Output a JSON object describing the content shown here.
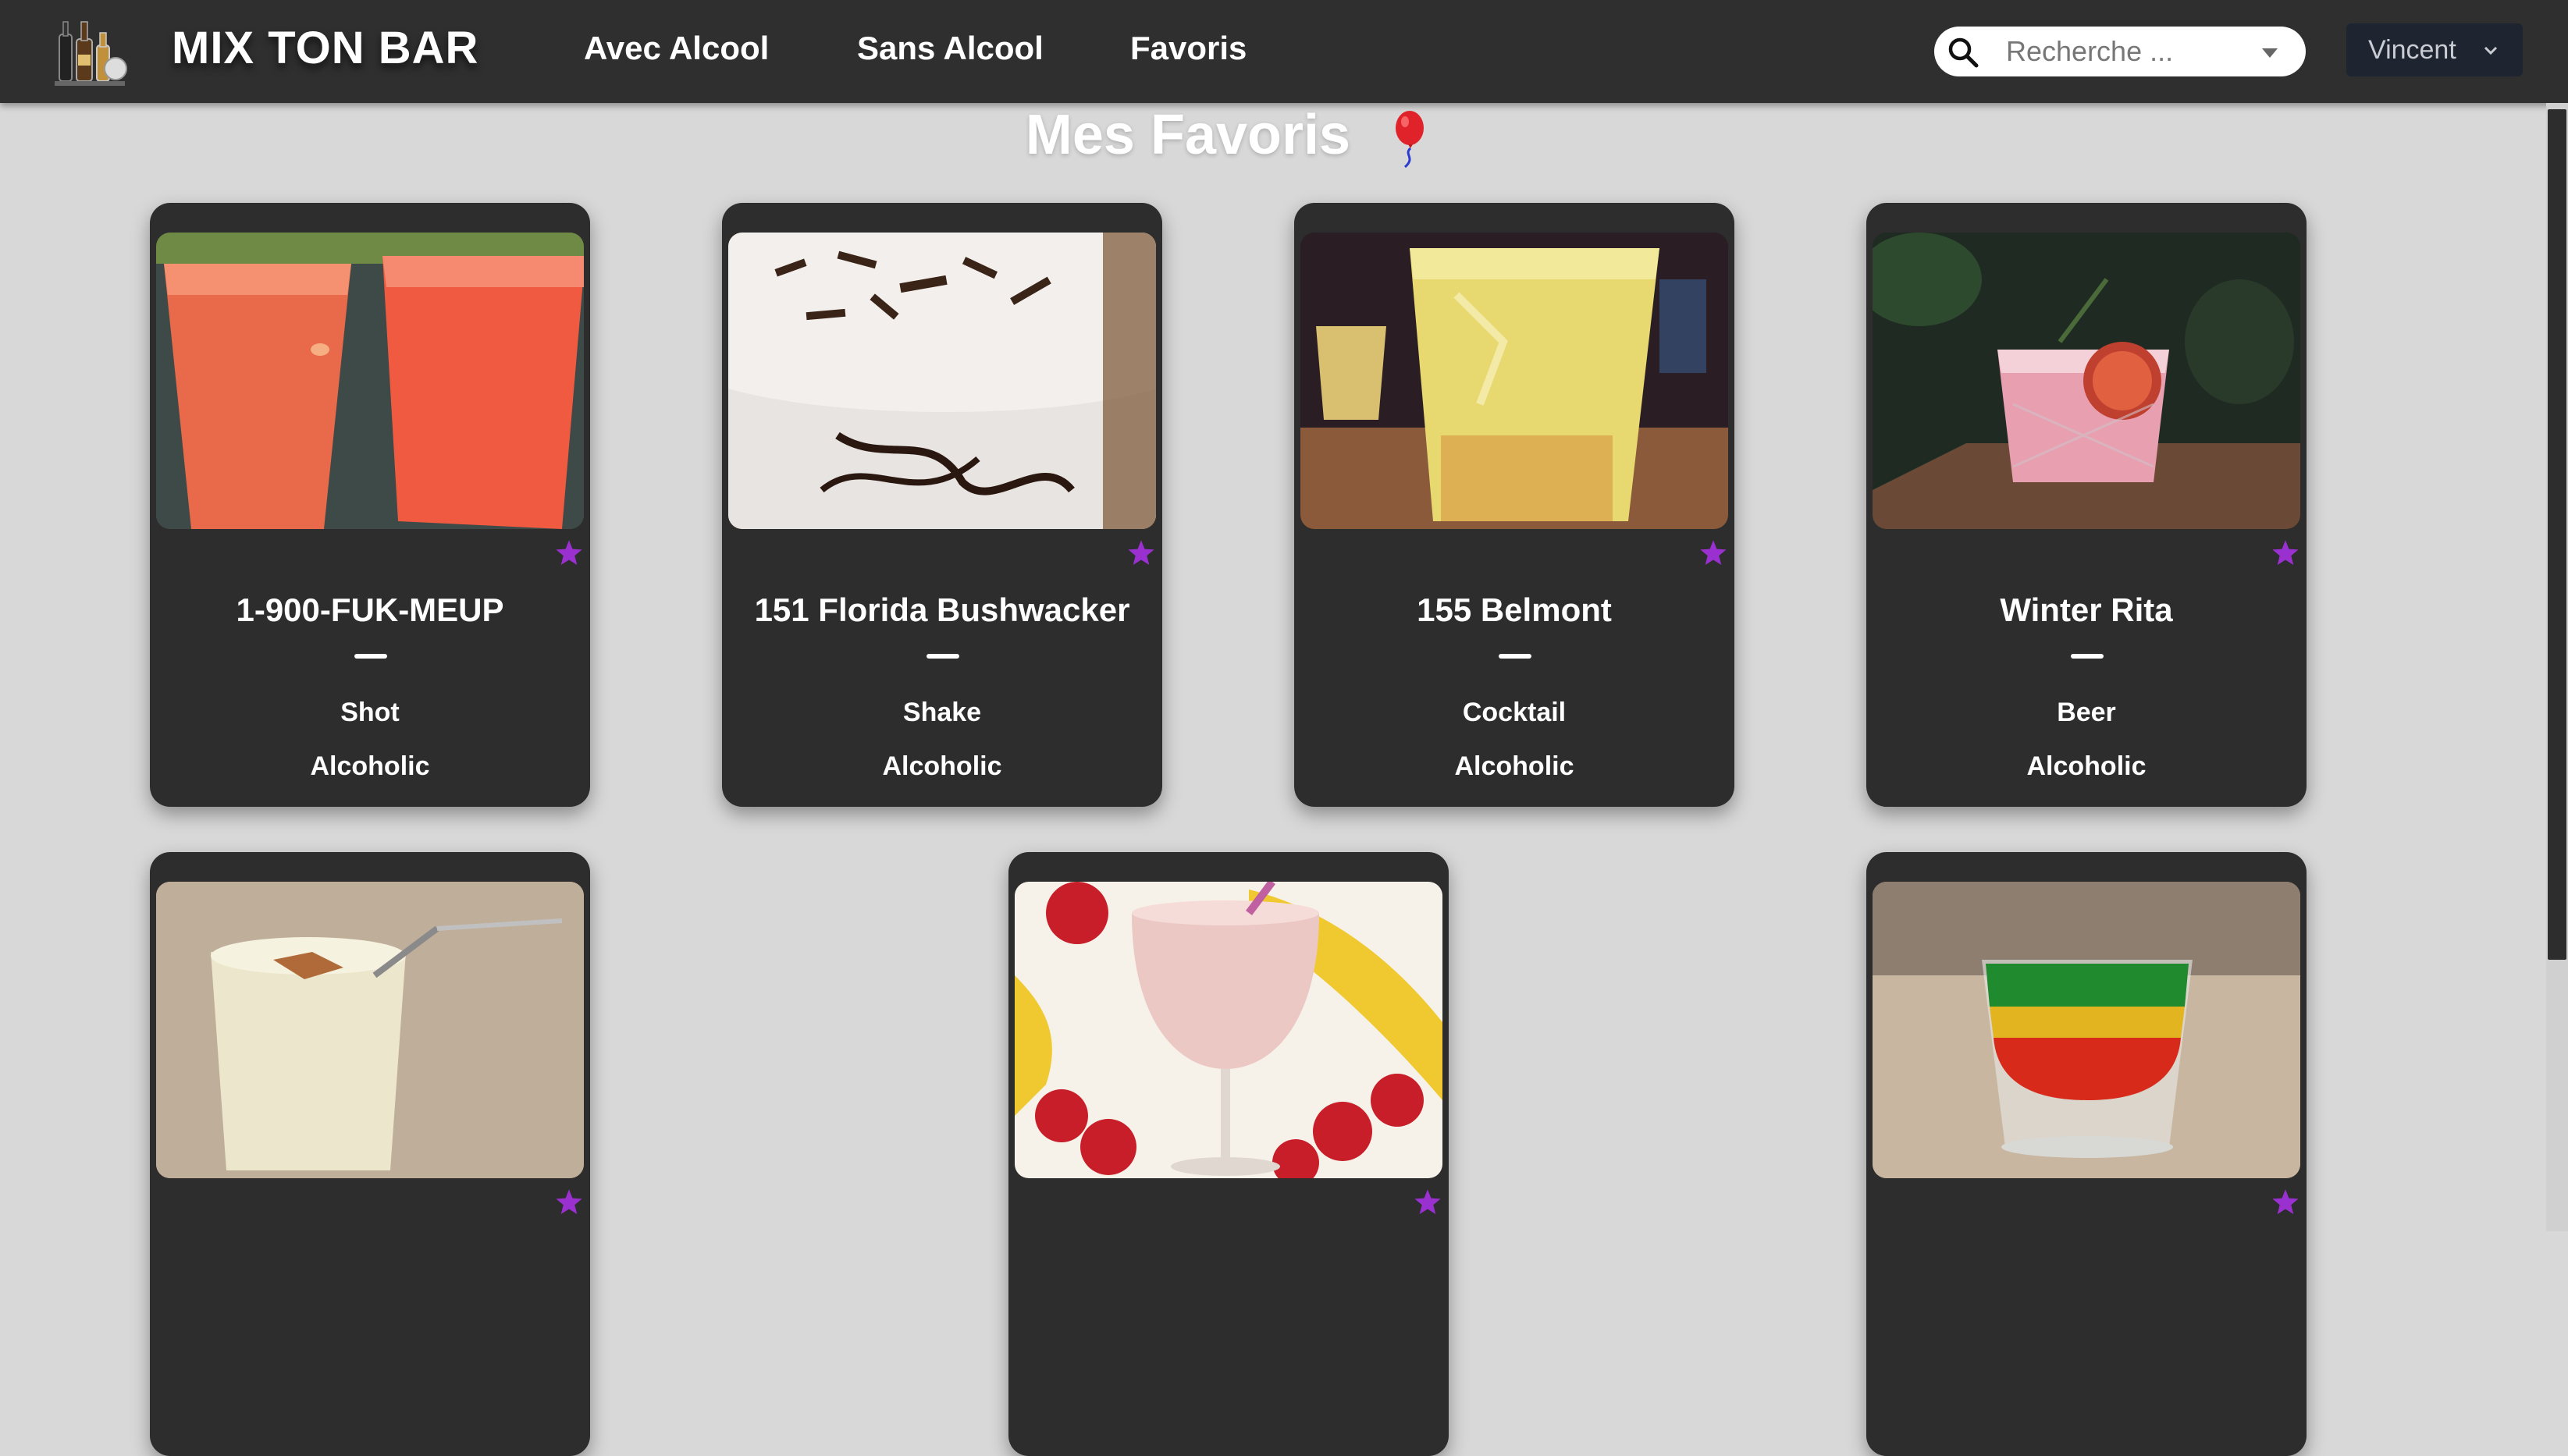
{
  "brand": {
    "name": "MIX TON BAR",
    "logo_icon": "bar-bottles-logo-icon"
  },
  "nav": {
    "items": [
      {
        "label": "Avec Alcool"
      },
      {
        "label": "Sans Alcool"
      },
      {
        "label": "Favoris"
      }
    ]
  },
  "search": {
    "placeholder": "Recherche ...",
    "value": "",
    "icon": "search-icon"
  },
  "user": {
    "name": "Vincent",
    "icon": "chevron-down-icon"
  },
  "page": {
    "title": "Mes Favoris",
    "title_icon": "balloon-icon"
  },
  "colors": {
    "navbar": "#2f2f2f",
    "background": "#d8d8d8",
    "card": "#2d2d2d",
    "star": "#9b30d0",
    "user_button": "#1e2430"
  },
  "cards": [
    {
      "name": "1-900-FUK-MEUP",
      "category": "Shot",
      "type": "Alcoholic",
      "favorite": true
    },
    {
      "name": "151 Florida Bushwacker",
      "category": "Shake",
      "type": "Alcoholic",
      "favorite": true
    },
    {
      "name": "155 Belmont",
      "category": "Cocktail",
      "type": "Alcoholic",
      "favorite": true
    },
    {
      "name": "Winter Rita",
      "category": "Beer",
      "type": "Alcoholic",
      "favorite": true
    },
    {
      "favorite": true
    },
    {
      "favorite": true
    },
    {
      "favorite": true
    }
  ]
}
